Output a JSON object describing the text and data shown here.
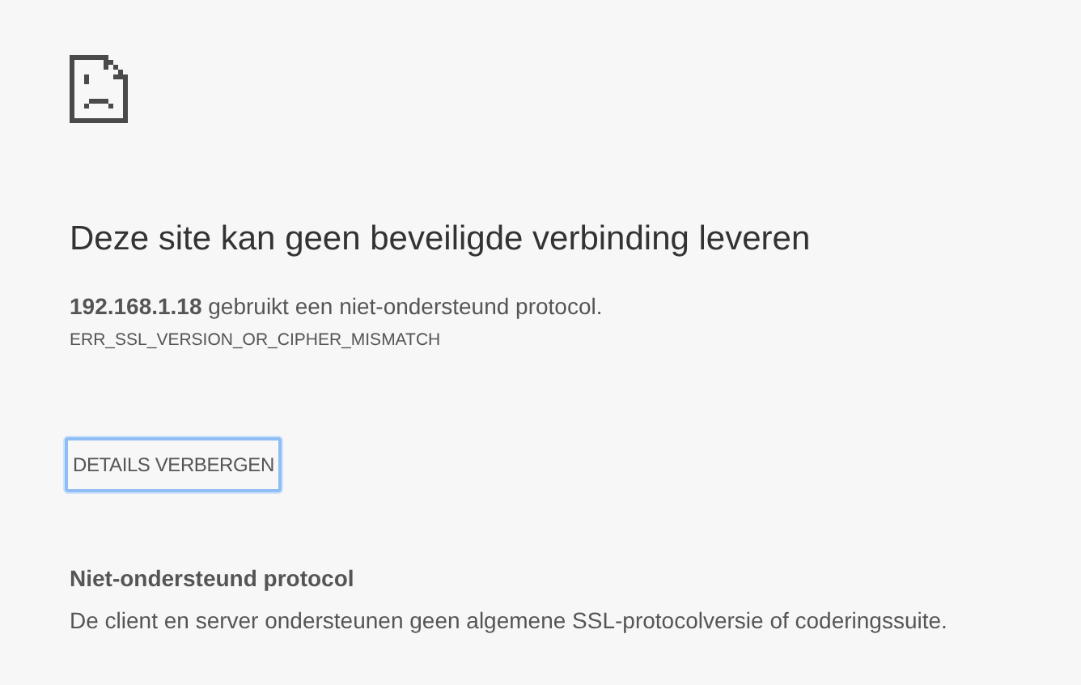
{
  "heading": "Deze site kan geen beveiligde verbinding leveren",
  "summary": "**192.168.1.18** gebruikt een niet-ondersteund protocol.",
  "error_code": "ERR_SSL_VERSION_OR_CIPHER_MISMATCH",
  "details_button": {
    "label": "DETAILS VERBERGEN",
    "focused": true
  },
  "details": {
    "title": "Niet-ondersteund protocol",
    "text": "De client en server ondersteunen geen algemene SSL-protocolversie of coderingssuite."
  }
}
